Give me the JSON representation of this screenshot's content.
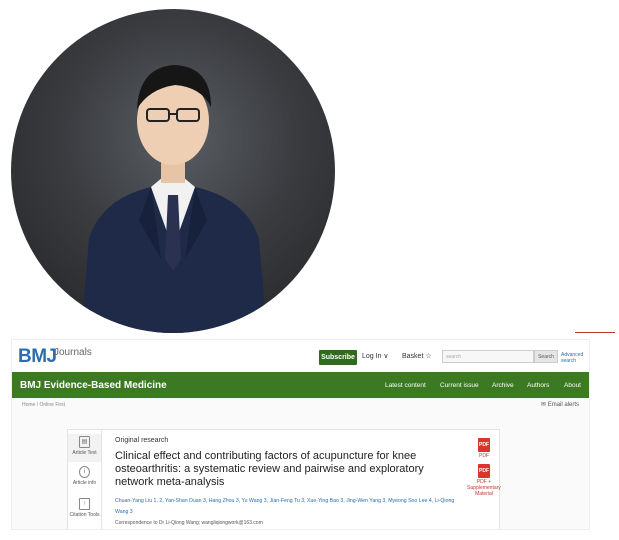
{
  "site": {
    "logo": "BMJ",
    "logo_sub": "Journals",
    "subscribe": "Subscribe",
    "login": "Log In ∨",
    "basket": "Basket ☆",
    "search_placeholder": "search",
    "search_button": "Search",
    "advanced_search": "Advanced search",
    "journal_title": "BMJ Evidence-Based Medicine",
    "nav": [
      "Latest content",
      "Current issue",
      "Archive",
      "Authors",
      "About"
    ],
    "breadcrumbs": "Home  /  Online First",
    "email_alerts": "✉ Email alerts"
  },
  "article": {
    "type": "Original research",
    "title": "Clinical effect and contributing factors of acupuncture for knee osteoarthritis: a systematic review and pairwise and exploratory network meta-analysis",
    "authors": "Chuan-Yang Liu 1, 2, Yan-Shan Duan 3, Hang Zhou 3, Yu Wang 3, Jian-Feng Tu 3, Xue-Ying Bao 3, Jing-Wen Yang 3, Myeong Soo Lee 4, Li-Qiong Wang 3",
    "correspondence": "Correspondence to Dr Li-Qiong Wang; wangliqiongwork@163.com"
  },
  "tools": [
    {
      "icon": "▤",
      "label": "Article Text"
    },
    {
      "icon": "i",
      "label": "Article info"
    },
    {
      "icon": "↑",
      "label": "Citation Tools"
    }
  ],
  "downloads": [
    {
      "icon": "PDF",
      "label": "PDF"
    },
    {
      "icon": "PDF",
      "label": "PDF + Supplementary Material"
    }
  ],
  "colors": {
    "brand_green": "#3b7a22",
    "bmj_blue": "#2a6db0",
    "pdf_red": "#d9362b"
  }
}
